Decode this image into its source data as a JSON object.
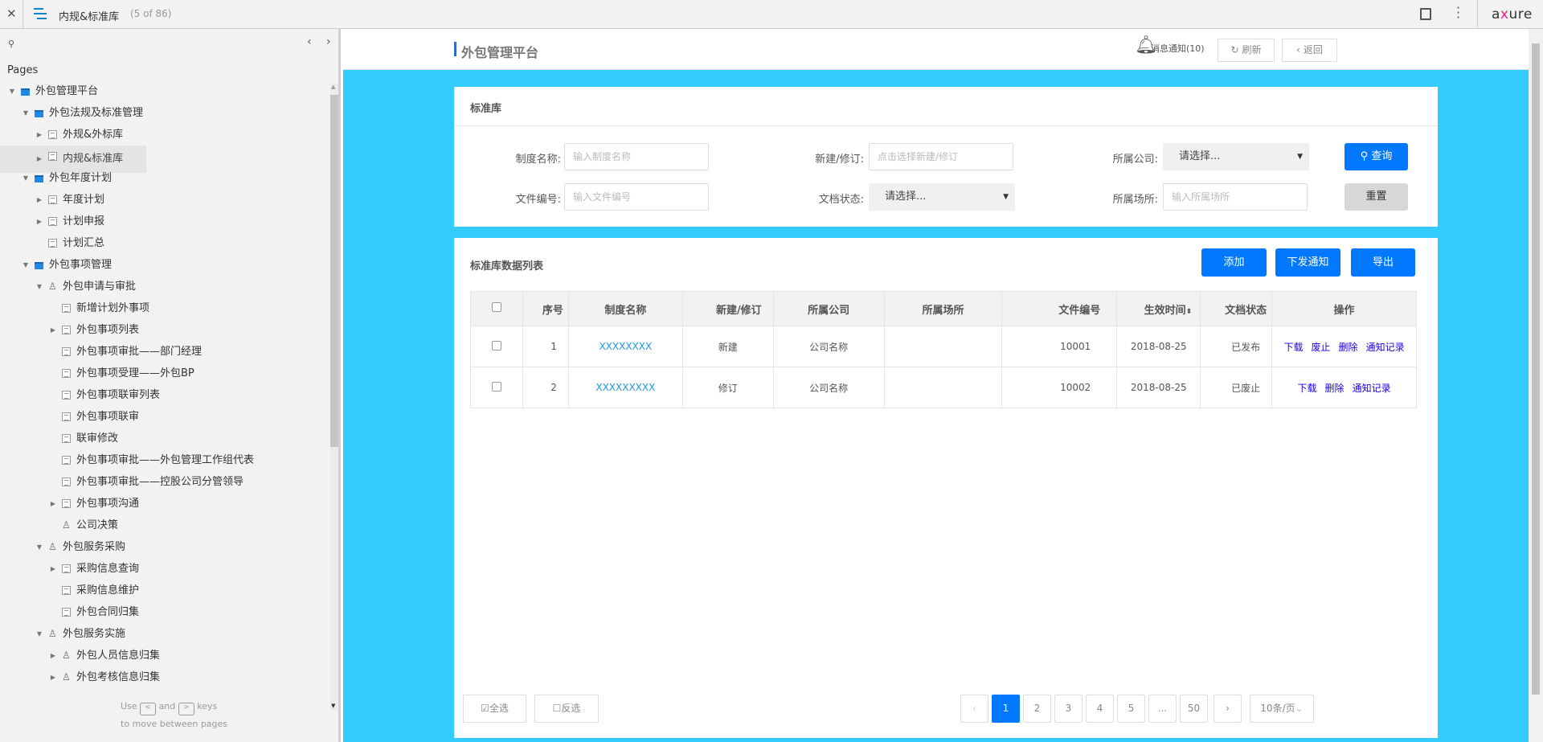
{
  "topbar": {
    "close_icon": "close-icon",
    "menu_icon": "hamburger-icon",
    "page_title": "内规&标准库",
    "page_count": "(5 of 86)",
    "notes_icon": "notes-icon",
    "more_icon": "more-vertical-icon",
    "logo": "axure"
  },
  "sidebar": {
    "heading": "Pages",
    "hint_use": "Use",
    "hint_and": "and",
    "hint_keys": "keys",
    "hint_key_prev": "<",
    "hint_key_next": ">",
    "hint_line2": "to move between pages",
    "tree": [
      {
        "label": "外包管理平台",
        "level": 0,
        "toggle": "expanded",
        "icon": "folder"
      },
      {
        "label": "外包法规及标准管理",
        "level": 1,
        "toggle": "expanded",
        "icon": "folder"
      },
      {
        "label": "外规&外标库",
        "level": 2,
        "toggle": "collapsed",
        "icon": "page"
      },
      {
        "label": "内规&标准库",
        "level": 2,
        "toggle": "collapsed",
        "icon": "page",
        "selected": true
      },
      {
        "label": "外包年度计划",
        "level": 1,
        "toggle": "expanded",
        "icon": "folder"
      },
      {
        "label": "年度计划",
        "level": 2,
        "toggle": "collapsed",
        "icon": "page"
      },
      {
        "label": "计划申报",
        "level": 2,
        "toggle": "collapsed",
        "icon": "page"
      },
      {
        "label": "计划汇总",
        "level": 2,
        "toggle": "none",
        "icon": "page"
      },
      {
        "label": "外包事项管理",
        "level": 1,
        "toggle": "expanded",
        "icon": "folder"
      },
      {
        "label": "外包申请与审批",
        "level": 2,
        "toggle": "expanded",
        "icon": "flow"
      },
      {
        "label": "新增计划外事项",
        "level": 3,
        "toggle": "none",
        "icon": "page"
      },
      {
        "label": "外包事项列表",
        "level": 3,
        "toggle": "collapsed",
        "icon": "page"
      },
      {
        "label": "外包事项审批——部门经理",
        "level": 3,
        "toggle": "none",
        "icon": "page"
      },
      {
        "label": "外包事项受理——外包BP",
        "level": 3,
        "toggle": "none",
        "icon": "page"
      },
      {
        "label": "外包事项联审列表",
        "level": 3,
        "toggle": "none",
        "icon": "page"
      },
      {
        "label": "外包事项联审",
        "level": 3,
        "toggle": "none",
        "icon": "page"
      },
      {
        "label": "联审修改",
        "level": 3,
        "toggle": "none",
        "icon": "page"
      },
      {
        "label": "外包事项审批——外包管理工作组代表",
        "level": 3,
        "toggle": "none",
        "icon": "page"
      },
      {
        "label": "外包事项审批——控股公司分管领导",
        "level": 3,
        "toggle": "none",
        "icon": "page"
      },
      {
        "label": "外包事项沟通",
        "level": 3,
        "toggle": "collapsed",
        "icon": "page"
      },
      {
        "label": "公司决策",
        "level": 3,
        "toggle": "none",
        "icon": "flow"
      },
      {
        "label": "外包服务采购",
        "level": 2,
        "toggle": "expanded",
        "icon": "flow"
      },
      {
        "label": "采购信息查询",
        "level": 3,
        "toggle": "collapsed",
        "icon": "page"
      },
      {
        "label": "采购信息维护",
        "level": 3,
        "toggle": "none",
        "icon": "page"
      },
      {
        "label": "外包合同归集",
        "level": 3,
        "toggle": "none",
        "icon": "page"
      },
      {
        "label": "外包服务实施",
        "level": 2,
        "toggle": "expanded",
        "icon": "flow"
      },
      {
        "label": "外包人员信息归集",
        "level": 3,
        "toggle": "collapsed",
        "icon": "flow"
      },
      {
        "label": "外包考核信息归集",
        "level": 3,
        "toggle": "collapsed",
        "icon": "flow"
      }
    ]
  },
  "header": {
    "title": "外包管理平台",
    "notify": "消息通知(10)",
    "refresh": "刷新",
    "back": "返回"
  },
  "search": {
    "card_title": "标准库",
    "name_label": "制度名称:",
    "name_placeholder": "输入制度名称",
    "type_label": "新建/修订:",
    "type_placeholder": "点击选择新建/修订",
    "company_label": "所属公司:",
    "company_value": "请选择...",
    "docno_label": "文件编号:",
    "docno_placeholder": "输入文件编号",
    "status_label": "文档状态:",
    "status_value": "请选择...",
    "place_label": "所属场所:",
    "place_placeholder": "输入所属场所",
    "query": "查询",
    "reset": "重置"
  },
  "list": {
    "title": "标准库数据列表",
    "add": "添加",
    "notify": "下发通知",
    "export": "导出",
    "columns": [
      "序号",
      "制度名称",
      "新建/修订",
      "所属公司",
      "所属场所",
      "文件编号",
      "生效时间",
      "文档状态",
      "操作"
    ],
    "rows": [
      {
        "no": "1",
        "name": "XXXXXXXX",
        "type": "新建",
        "company": "公司名称",
        "place": "",
        "docno": "10001",
        "date": "2018-08-25",
        "status": "已发布",
        "ops": [
          "下载",
          "废止",
          "删除",
          "通知记录"
        ]
      },
      {
        "no": "2",
        "name": "XXXXXXXXX",
        "type": "修订",
        "company": "公司名称",
        "place": "",
        "docno": "10002",
        "date": "2018-08-25",
        "status": "已废止",
        "ops": [
          "下载",
          "删除",
          "通知记录"
        ]
      }
    ]
  },
  "footer": {
    "select_all": "全选",
    "invert": "反选",
    "pages": [
      "1",
      "2",
      "3",
      "4",
      "5",
      "...",
      "50"
    ],
    "current_page": "1",
    "page_size": "10条/页"
  },
  "colors": {
    "accent": "#0079fe",
    "background": "#33ccff",
    "link": "#1a98e6",
    "op_link": "#1a00ee"
  }
}
